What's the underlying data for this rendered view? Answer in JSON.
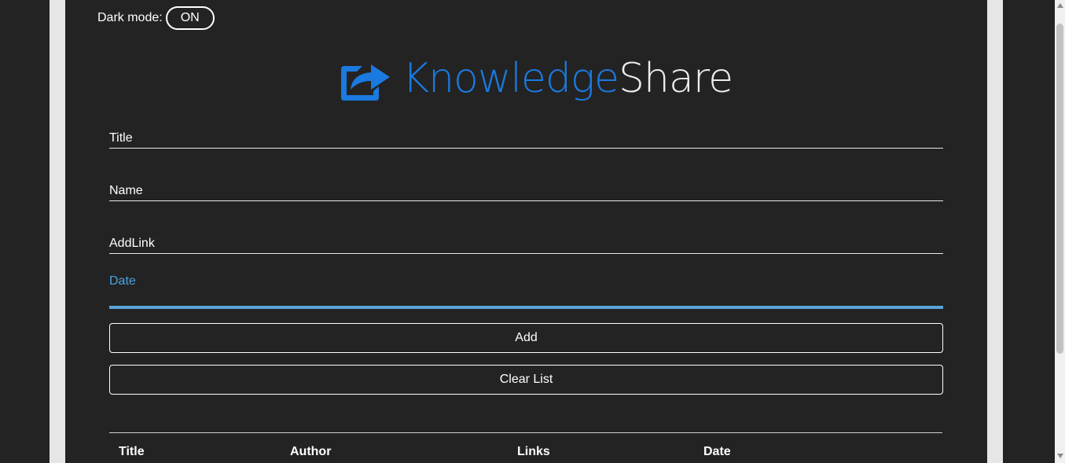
{
  "dark_mode": {
    "label": "Dark mode:",
    "toggle_value": "ON"
  },
  "logo": {
    "text_part1": "Knowledge",
    "text_part2": "Share",
    "icon": "share-square-icon",
    "accent_color": "#1a7ae0"
  },
  "form": {
    "fields": [
      {
        "label": "Title"
      },
      {
        "label": "Name"
      },
      {
        "label": "AddLink"
      },
      {
        "label": "Date",
        "focused": true,
        "focus_color": "#5ba4d8"
      }
    ],
    "add_label": "Add",
    "clear_label": "Clear List"
  },
  "table": {
    "columns": [
      "Title",
      "Author",
      "Links",
      "Date"
    ]
  },
  "theme": {
    "background": "#232323",
    "side_strip": "#e6e6e6"
  }
}
